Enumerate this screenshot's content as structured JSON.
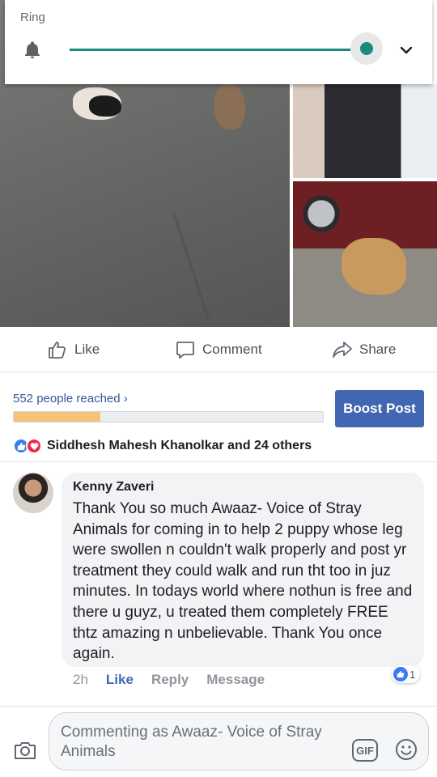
{
  "volume_panel": {
    "label": "Ring",
    "level": 0.96,
    "icons": {
      "stream": "bell-icon",
      "expand": "chevron-down-icon"
    },
    "accent_color": "#1a8a7a"
  },
  "post_photos": {
    "count": 3
  },
  "actions": {
    "like_label": "Like",
    "comment_label": "Comment",
    "share_label": "Share"
  },
  "insights": {
    "reach_text": "552 people reached ›",
    "reach_progress": 0.28,
    "boost_label": "Boost Post",
    "boost_color": "#4267b2"
  },
  "reactions": {
    "types": [
      "like",
      "love"
    ],
    "summary": "Siddhesh Mahesh Khanolkar and 24 others"
  },
  "comment": {
    "author": "Kenny Zaveri",
    "text": "Thank You so much Awaaz- Voice of Stray Animals for coming in to help 2 puppy whose leg were swollen n couldn't walk properly and post yr treatment they could walk and run tht too in juz minutes. In todays world where nothun is free and there u guyz, u treated them completely FREE thtz amazing n unbelievable. Thank You once again.",
    "time": "2h",
    "like_label": "Like",
    "reply_label": "Reply",
    "message_label": "Message",
    "like_count": "1"
  },
  "composer": {
    "placeholder": "Commenting as Awaaz- Voice of Stray Animals",
    "gif_label": "GIF",
    "icons": {
      "camera": "camera-icon",
      "emoji": "emoji-icon"
    }
  }
}
